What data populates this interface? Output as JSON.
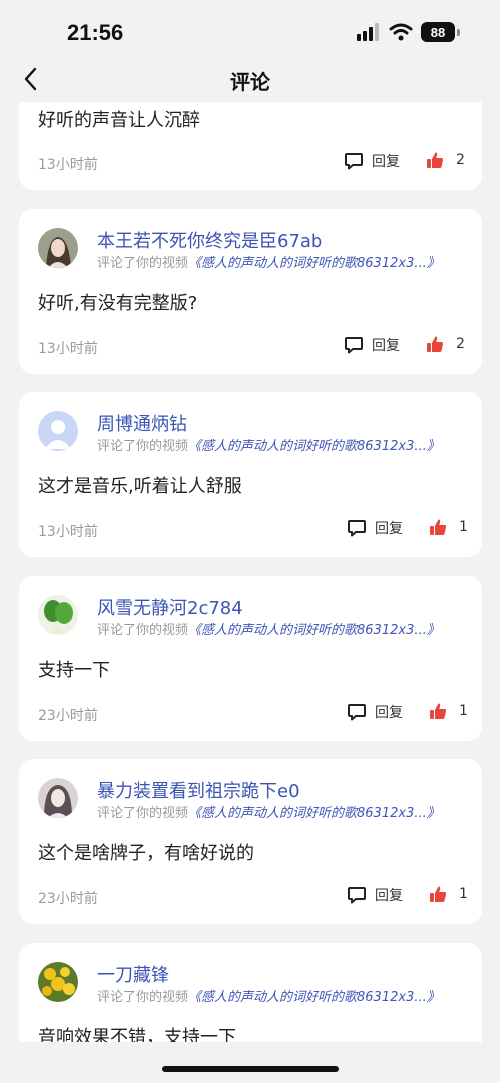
{
  "status": {
    "time": "21:56",
    "battery": "88"
  },
  "nav": {
    "title": "评论"
  },
  "colors": {
    "accent": "#3b55b5",
    "like": "#e8453c",
    "background": "#f2f2f5"
  },
  "reply_label": "回复",
  "comments": [
    {
      "user": "",
      "action": "",
      "video_title": "",
      "text": "好听的声音让人沉醉",
      "time": "13小时前",
      "likes": "2",
      "avatar_icon": ""
    },
    {
      "user": "本王若不死你终究是臣67ab",
      "action": "评论了你的视频",
      "video_title": "《感人的声动人的词好听的歌86312x3...》",
      "text": "好听,有没有完整版?",
      "time": "13小时前",
      "likes": "2",
      "avatar_icon": "portrait-avatar"
    },
    {
      "user": "周博通炳钻",
      "action": "评论了你的视频",
      "video_title": "《感人的声动人的词好听的歌86312x3...》",
      "text": "这才是音乐,听着让人舒服",
      "time": "13小时前",
      "likes": "1",
      "avatar_icon": "default-user-avatar"
    },
    {
      "user": "风雪无静河2c784",
      "action": "评论了你的视频",
      "video_title": "《感人的声动人的词好听的歌86312x3...》",
      "text": "支持一下",
      "time": "23小时前",
      "likes": "1",
      "avatar_icon": "bok-choy-avatar"
    },
    {
      "user": "暴力装置看到祖宗跪下e0",
      "action": "评论了你的视频",
      "video_title": "《感人的声动人的词好听的歌86312x3...》",
      "text": "这个是啥牌子，有啥好说的",
      "time": "23小时前",
      "likes": "1",
      "avatar_icon": "illustrated-portrait-avatar"
    },
    {
      "user": "一刀藏锋",
      "action": "评论了你的视频",
      "video_title": "《感人的声动人的词好听的歌86312x3...》",
      "text": "音响效果不错，支持一下",
      "time": "",
      "likes": "",
      "avatar_icon": "yellow-flowers-avatar"
    }
  ]
}
